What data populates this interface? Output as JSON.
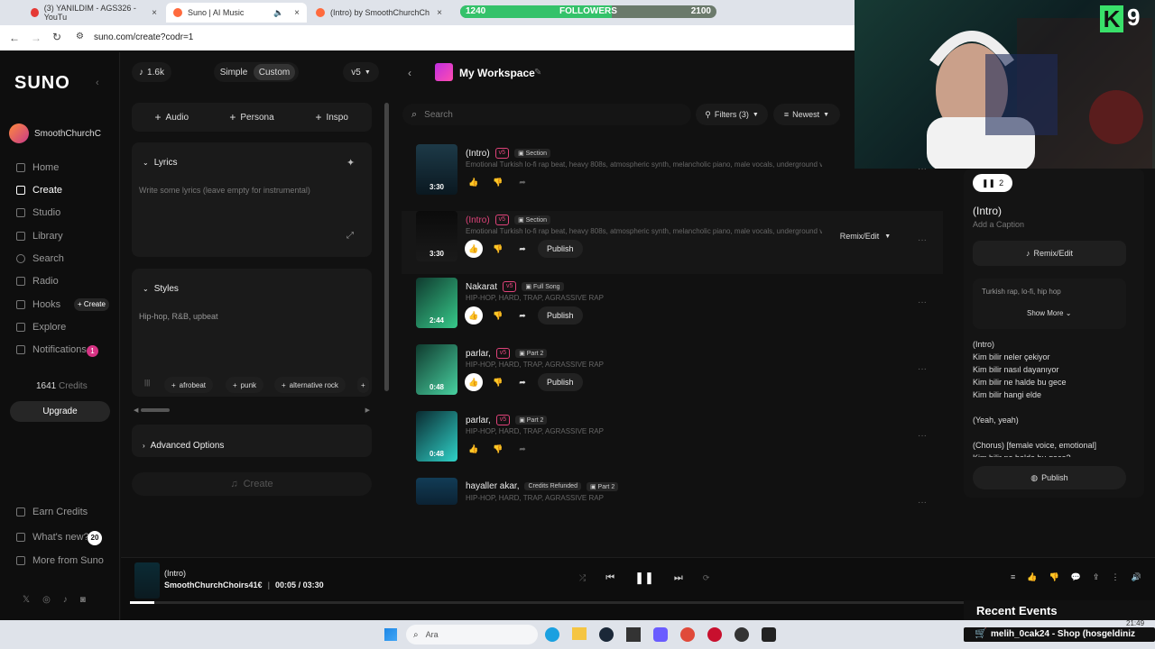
{
  "tabs": [
    {
      "title": "(3) YANILDIM - AGS326 - YouTu",
      "color": "#e53935"
    },
    {
      "title": "Suno | AI Music",
      "color": "#ff6a3d"
    },
    {
      "title": "(Intro) by SmoothChurchChoirs",
      "color": "#ff6a3d"
    }
  ],
  "address": {
    "url": "suno.com/create?codr=1"
  },
  "followers": {
    "label": "FOLLOWERS",
    "current": "1240",
    "goal": "2100",
    "progress": 0.59
  },
  "webcam": {
    "channel_badge": "9"
  },
  "sidebar": {
    "logo": "SUNO",
    "user": "SmoothChurchC",
    "items": [
      {
        "label": "Home"
      },
      {
        "label": "Create"
      },
      {
        "label": "Studio"
      },
      {
        "label": "Library"
      },
      {
        "label": "Search"
      },
      {
        "label": "Radio"
      },
      {
        "label": "Hooks"
      },
      {
        "label": "Explore"
      },
      {
        "label": "Notifications"
      }
    ],
    "hooks_create": "+ Create",
    "notif_count": "1",
    "credits_num": "1641",
    "credits_label": "Credits",
    "upgrade": "Upgrade",
    "earn": "Earn Credits",
    "whats_new": "What's new?",
    "whats_new_count": "20",
    "more": "More from Suno"
  },
  "create": {
    "count": "1.6k",
    "mode_simple": "Simple",
    "mode_custom": "Custom",
    "version": "v5",
    "add_audio": "Audio",
    "add_persona": "Persona",
    "add_inspo": "Inspo",
    "lyrics_label": "Lyrics",
    "lyrics_placeholder": "Write some lyrics (leave empty for instrumental)",
    "styles_label": "Styles",
    "styles_value": "Hip-hop, R&B, upbeat",
    "chips": [
      "afrobeat",
      "punk",
      "alternative rock"
    ],
    "advanced": "Advanced Options",
    "create_btn": "Create"
  },
  "workspace": {
    "title": "My Workspace",
    "search_placeholder": "Search",
    "filters": "Filters (3)",
    "sort": "Newest",
    "remix": "Remix/Edit",
    "songs": [
      {
        "title": "(Intro)",
        "tag": "v5",
        "badge": "Section",
        "desc": "Emotional Turkish lo-fi rap beat, heavy 808s, atmospheric synth, melancholic piano, male vocals, underground vibe,...",
        "dur": "3:30"
      },
      {
        "title": "(Intro)",
        "tag": "v5",
        "badge": "Section",
        "desc": "Emotional Turkish lo-fi rap beat, heavy 808s, atmospheric synth, melancholic piano, male vocals, underground vibe,...",
        "dur": "3:30"
      },
      {
        "title": "Nakarat",
        "tag": "v5",
        "badge": "Full Song",
        "desc": "HIP-HOP, HARD, TRAP, AGRASSIVE RAP",
        "dur": "2:44"
      },
      {
        "title": "parlar,",
        "tag": "v5",
        "badge": "Part 2",
        "desc": "HIP-HOP, HARD, TRAP, AGRASSIVE RAP",
        "dur": "0:48"
      },
      {
        "title": "parlar,",
        "tag": "v5",
        "badge": "Part 2",
        "desc": "HIP-HOP, HARD, TRAP, AGRASSIVE RAP",
        "dur": "0:48"
      },
      {
        "title": "hayaller akar,",
        "tag": "Credits Refunded",
        "badge": "Part 2",
        "desc": "HIP-HOP, HARD, TRAP, AGRASSIVE RAP",
        "dur": ""
      }
    ],
    "publish": "Publish"
  },
  "right_panel": {
    "likes": "2",
    "title": "(Intro)",
    "caption": "Add a Caption",
    "remix": "Remix/Edit",
    "style": "Turkish rap, lo-fi, hip hop",
    "show_more": "Show More",
    "lyrics": [
      "(Intro)",
      "Kim bilir neler çekiyor",
      "Kim bilir nasıl dayanıyor",
      "Kim bilir ne halde bu gece",
      "Kim bilir hangi elde",
      "",
      "(Yeah, yeah)",
      "",
      "(Chorus) [female voice, emotional]",
      "Kim bilir ne halde bu gece?"
    ],
    "publish": "Publish"
  },
  "player": {
    "title": "(Intro)",
    "artist": "SmoothChurchChoirs41€",
    "current": "00:05",
    "total": "03:30",
    "progress": 0.024
  },
  "overlay": {
    "recent_events": "Recent Events",
    "event": "melih_0cak24 - Shop (hosgeldiniz"
  },
  "taskbar": {
    "search": "Ara",
    "time": "21:49"
  }
}
